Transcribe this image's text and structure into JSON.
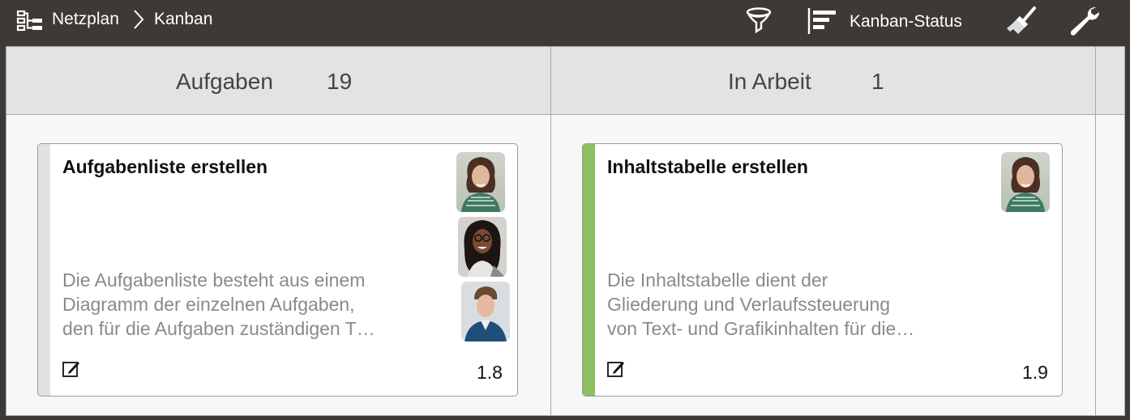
{
  "breadcrumb": {
    "root": "Netzplan",
    "current": "Kanban"
  },
  "toolbar": {
    "kanban_status_label": "Kanban-Status",
    "icons": [
      "outline-icon",
      "filter-icon",
      "kanban-status-icon",
      "brush-icon",
      "wrench-icon"
    ]
  },
  "columns": [
    {
      "title": "Aufgaben",
      "count": "19"
    },
    {
      "title": "In Arbeit",
      "count": "1"
    }
  ],
  "cards": [
    {
      "title": "Aufgabenliste erstellen",
      "description_lines": [
        "Die Aufgabenliste besteht aus einem",
        "Diagramm der einzelnen Aufgaben,",
        "den für die Aufgaben zuständigen T…"
      ],
      "id": "1.8",
      "stripe_color": "#e1e1e1",
      "avatars": [
        "avatar-woman-curly-hair",
        "avatar-woman-glasses",
        "avatar-young-man"
      ]
    },
    {
      "title": "Inhaltstabelle erstellen",
      "description_lines": [
        "Die Inhaltstabelle dient der",
        "Gliederung und Verlaufssteuerung",
        "von Text- und Grafikinhalten für die…"
      ],
      "id": "1.9",
      "stripe_color": "#8cc063",
      "avatars": [
        "avatar-woman-curly-hair"
      ]
    }
  ],
  "colors": {
    "toolbar_bg": "#3e3935",
    "header_bg": "#e3e3e3",
    "board_bg": "#f7f7f7",
    "in_progress_accent": "#8cc063"
  }
}
